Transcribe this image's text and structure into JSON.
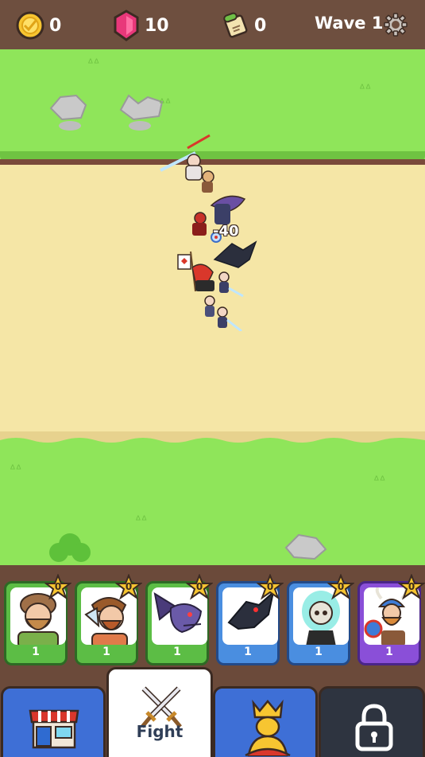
{
  "resources": {
    "gold": "0",
    "gems": "10",
    "scrolls": "0"
  },
  "wave_label": "Wave 1",
  "damage_popup": "-40",
  "colors": {
    "grass": "#8fe55a",
    "road": "#f5e6a6",
    "frame": "#6b4a3a",
    "card_green": "#5cbd45",
    "card_blue": "#4a8ee0",
    "card_purple": "#8a4fd8",
    "tab_blue": "#3e6fd6",
    "tab_dark": "#2e3440"
  },
  "units": [
    {
      "name": "peasant-card",
      "icon": "bearded-peasant-icon",
      "level": "1",
      "stars": "0",
      "rarity": "common"
    },
    {
      "name": "axeman-card",
      "icon": "axe-warrior-icon",
      "level": "1",
      "stars": "0",
      "rarity": "common"
    },
    {
      "name": "dragon-card",
      "icon": "purple-dragon-icon",
      "level": "1",
      "stars": "0",
      "rarity": "common"
    },
    {
      "name": "raven-card",
      "icon": "black-raven-icon",
      "level": "1",
      "stars": "0",
      "rarity": "rare"
    },
    {
      "name": "ghost-card",
      "icon": "skull-ghost-icon",
      "level": "1",
      "stars": "0",
      "rarity": "rare"
    },
    {
      "name": "viking-card",
      "icon": "viking-dwarf-icon",
      "level": "1",
      "stars": "0",
      "rarity": "epic"
    }
  ],
  "nav": {
    "shop_icon": "shop-icon",
    "fight_label": "Fight",
    "fight_icon": "crossed-swords-icon",
    "king_icon": "king-crown-icon",
    "locked_icon": "padlock-icon"
  }
}
